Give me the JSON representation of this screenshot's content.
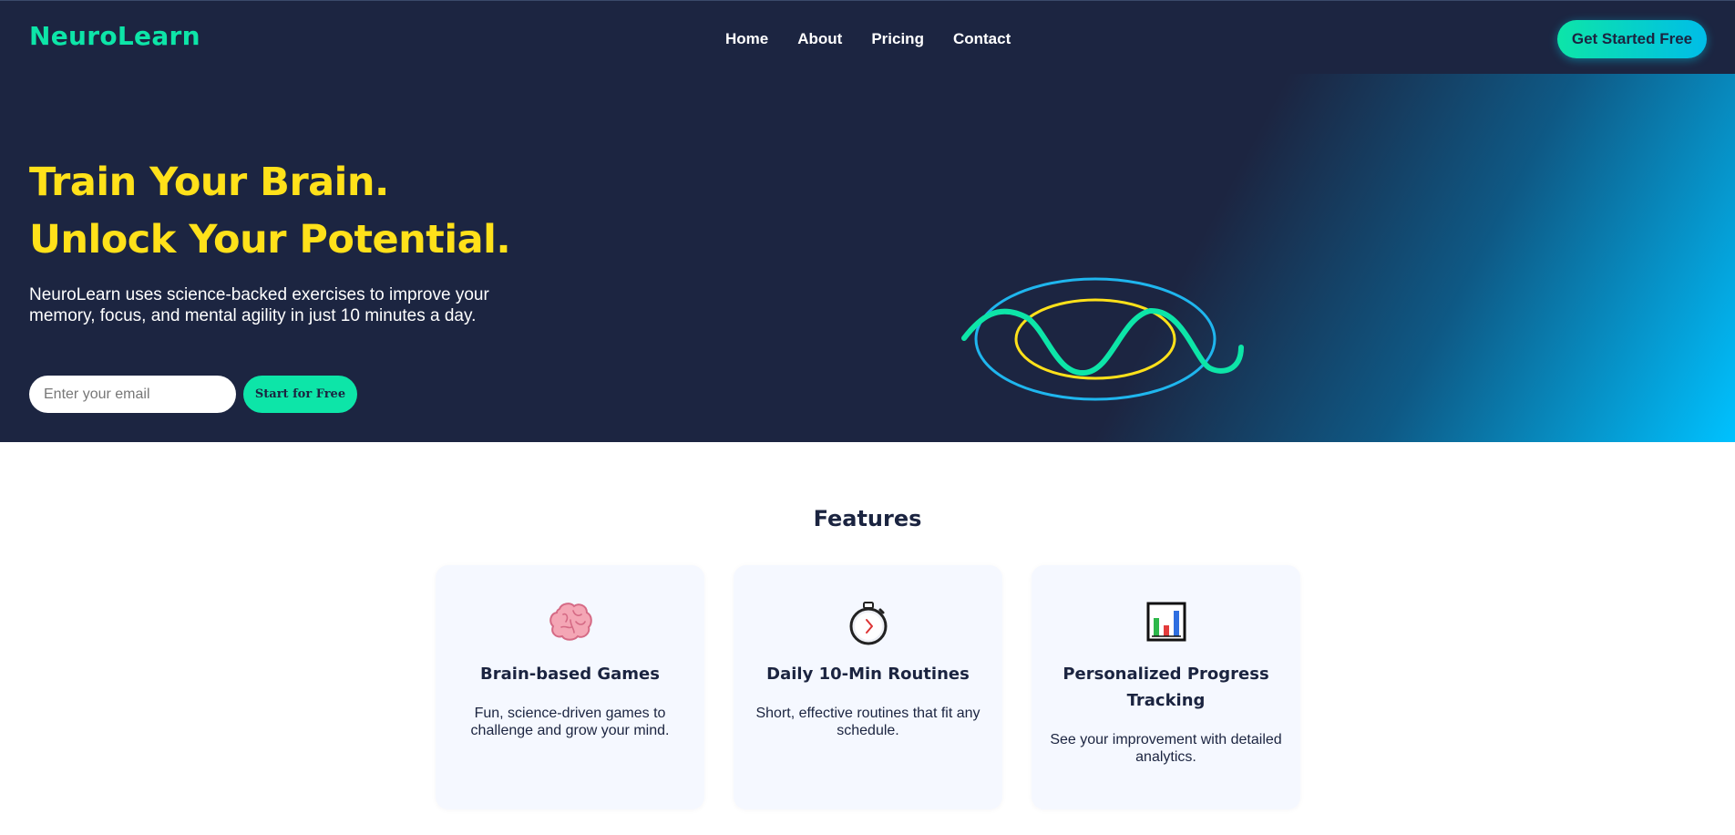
{
  "brand": {
    "name": "NeuroLearn"
  },
  "nav": {
    "items": [
      "Home",
      "About",
      "Pricing",
      "Contact"
    ]
  },
  "header": {
    "cta_label": "Get Started Free"
  },
  "hero": {
    "headline_line1": "Train Your Brain.",
    "headline_line2": "Unlock Your Potential.",
    "subtitle": "NeuroLearn uses science-backed exercises to improve your memory, focus, and mental agility in just 10 minutes a day.",
    "email_placeholder": "Enter your email",
    "start_label": "Start for Free"
  },
  "features": {
    "title": "Features",
    "cards": [
      {
        "icon": "brain-icon",
        "title": "Brain-based Games",
        "description": "Fun, science-driven games to challenge and grow your mind."
      },
      {
        "icon": "stopwatch-icon",
        "title": "Daily 10-Min Routines",
        "description": "Short, effective routines that fit any schedule."
      },
      {
        "icon": "bar-chart-icon",
        "title": "Personalized Progress Tracking",
        "description": "See your improvement with detailed analytics."
      }
    ]
  },
  "colors": {
    "navy": "#1c2541",
    "accent_green": "#0de5a8",
    "accent_yellow": "#ffe11a",
    "accent_cyan": "#00c2ff",
    "card_bg": "#f5f8ff"
  }
}
